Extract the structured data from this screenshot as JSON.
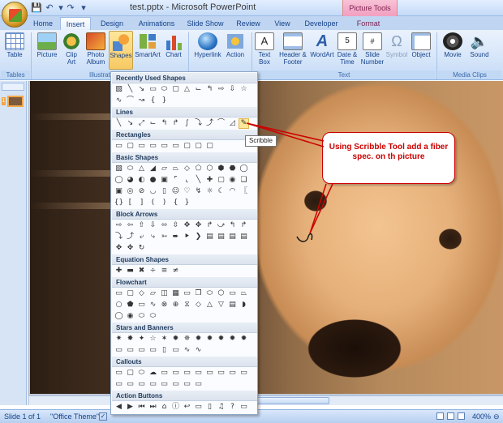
{
  "window": {
    "title": "test.pptx - Microsoft PowerPoint",
    "context_tab_group": "Picture Tools"
  },
  "tabs": [
    {
      "label": "Home"
    },
    {
      "label": "Insert",
      "active": true
    },
    {
      "label": "Design"
    },
    {
      "label": "Animations"
    },
    {
      "label": "Slide Show"
    },
    {
      "label": "Review"
    },
    {
      "label": "View"
    },
    {
      "label": "Developer"
    },
    {
      "label": "Format"
    }
  ],
  "ribbon": {
    "buttons": [
      {
        "label": "Table",
        "icon": "table-icon"
      },
      {
        "label": "Picture",
        "icon": "picture-icon"
      },
      {
        "label": "Clip Art",
        "icon": "clip-art-icon"
      },
      {
        "label": "Photo Album",
        "icon": "photo-album-icon"
      },
      {
        "label": "Shapes",
        "icon": "shapes-icon"
      },
      {
        "label": "SmartArt",
        "icon": "smartart-icon"
      },
      {
        "label": "Chart",
        "icon": "chart-icon"
      },
      {
        "label": "Hyperlink",
        "icon": "hyperlink-icon"
      },
      {
        "label": "Action",
        "icon": "action-icon"
      },
      {
        "label": "Text Box",
        "icon": "text-box-icon"
      },
      {
        "label": "Header & Footer",
        "icon": "header-footer-icon"
      },
      {
        "label": "WordArt",
        "icon": "wordart-icon"
      },
      {
        "label": "Date & Time",
        "icon": "date-time-icon"
      },
      {
        "label": "Slide Number",
        "icon": "slide-number-icon"
      },
      {
        "label": "Symbol",
        "icon": "symbol-icon"
      },
      {
        "label": "Object",
        "icon": "object-icon"
      },
      {
        "label": "Movie",
        "icon": "movie-icon"
      },
      {
        "label": "Sound",
        "icon": "sound-icon"
      }
    ],
    "groups": [
      "Tables",
      "Illustrati",
      "Text",
      "Media Clips"
    ]
  },
  "slide_thumbnail": {
    "number": "1"
  },
  "shapes_menu": {
    "sections": [
      "Recently Used Shapes",
      "Lines",
      "Rectangles",
      "Basic Shapes",
      "Block Arrows",
      "Equation Shapes",
      "Flowchart",
      "Stars and Banners",
      "Callouts",
      "Action Buttons"
    ],
    "tooltip": "Scribble"
  },
  "annotation": {
    "text": "Using Scribble Tool add a fiber spec. on th picture",
    "color": "#cc0000"
  },
  "status": {
    "slide": "Slide 1 of 1",
    "theme": "\"Office Theme\"",
    "zoom": "400%"
  }
}
